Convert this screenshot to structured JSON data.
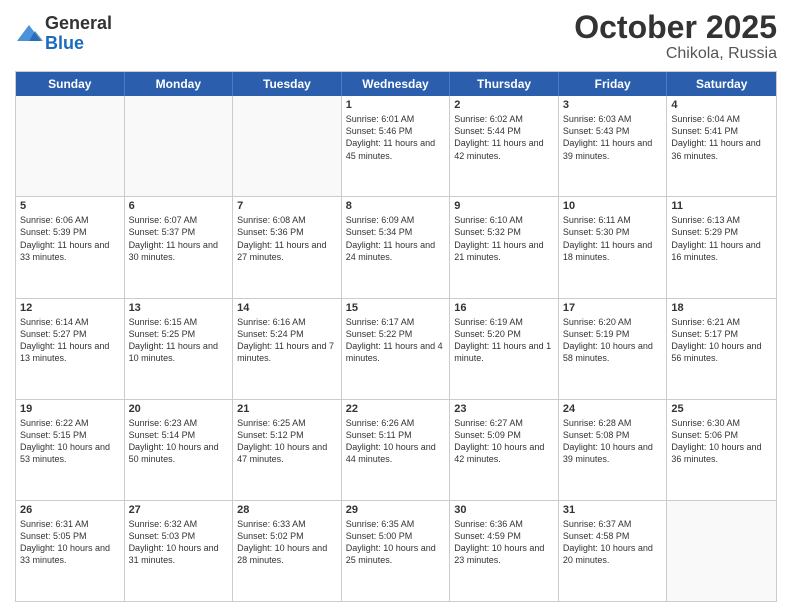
{
  "logo": {
    "general": "General",
    "blue": "Blue"
  },
  "header": {
    "month": "October 2025",
    "location": "Chikola, Russia"
  },
  "days": [
    "Sunday",
    "Monday",
    "Tuesday",
    "Wednesday",
    "Thursday",
    "Friday",
    "Saturday"
  ],
  "rows": [
    [
      {
        "day": "",
        "text": ""
      },
      {
        "day": "",
        "text": ""
      },
      {
        "day": "",
        "text": ""
      },
      {
        "day": "1",
        "text": "Sunrise: 6:01 AM\nSunset: 5:46 PM\nDaylight: 11 hours and 45 minutes."
      },
      {
        "day": "2",
        "text": "Sunrise: 6:02 AM\nSunset: 5:44 PM\nDaylight: 11 hours and 42 minutes."
      },
      {
        "day": "3",
        "text": "Sunrise: 6:03 AM\nSunset: 5:43 PM\nDaylight: 11 hours and 39 minutes."
      },
      {
        "day": "4",
        "text": "Sunrise: 6:04 AM\nSunset: 5:41 PM\nDaylight: 11 hours and 36 minutes."
      }
    ],
    [
      {
        "day": "5",
        "text": "Sunrise: 6:06 AM\nSunset: 5:39 PM\nDaylight: 11 hours and 33 minutes."
      },
      {
        "day": "6",
        "text": "Sunrise: 6:07 AM\nSunset: 5:37 PM\nDaylight: 11 hours and 30 minutes."
      },
      {
        "day": "7",
        "text": "Sunrise: 6:08 AM\nSunset: 5:36 PM\nDaylight: 11 hours and 27 minutes."
      },
      {
        "day": "8",
        "text": "Sunrise: 6:09 AM\nSunset: 5:34 PM\nDaylight: 11 hours and 24 minutes."
      },
      {
        "day": "9",
        "text": "Sunrise: 6:10 AM\nSunset: 5:32 PM\nDaylight: 11 hours and 21 minutes."
      },
      {
        "day": "10",
        "text": "Sunrise: 6:11 AM\nSunset: 5:30 PM\nDaylight: 11 hours and 18 minutes."
      },
      {
        "day": "11",
        "text": "Sunrise: 6:13 AM\nSunset: 5:29 PM\nDaylight: 11 hours and 16 minutes."
      }
    ],
    [
      {
        "day": "12",
        "text": "Sunrise: 6:14 AM\nSunset: 5:27 PM\nDaylight: 11 hours and 13 minutes."
      },
      {
        "day": "13",
        "text": "Sunrise: 6:15 AM\nSunset: 5:25 PM\nDaylight: 11 hours and 10 minutes."
      },
      {
        "day": "14",
        "text": "Sunrise: 6:16 AM\nSunset: 5:24 PM\nDaylight: 11 hours and 7 minutes."
      },
      {
        "day": "15",
        "text": "Sunrise: 6:17 AM\nSunset: 5:22 PM\nDaylight: 11 hours and 4 minutes."
      },
      {
        "day": "16",
        "text": "Sunrise: 6:19 AM\nSunset: 5:20 PM\nDaylight: 11 hours and 1 minute."
      },
      {
        "day": "17",
        "text": "Sunrise: 6:20 AM\nSunset: 5:19 PM\nDaylight: 10 hours and 58 minutes."
      },
      {
        "day": "18",
        "text": "Sunrise: 6:21 AM\nSunset: 5:17 PM\nDaylight: 10 hours and 56 minutes."
      }
    ],
    [
      {
        "day": "19",
        "text": "Sunrise: 6:22 AM\nSunset: 5:15 PM\nDaylight: 10 hours and 53 minutes."
      },
      {
        "day": "20",
        "text": "Sunrise: 6:23 AM\nSunset: 5:14 PM\nDaylight: 10 hours and 50 minutes."
      },
      {
        "day": "21",
        "text": "Sunrise: 6:25 AM\nSunset: 5:12 PM\nDaylight: 10 hours and 47 minutes."
      },
      {
        "day": "22",
        "text": "Sunrise: 6:26 AM\nSunset: 5:11 PM\nDaylight: 10 hours and 44 minutes."
      },
      {
        "day": "23",
        "text": "Sunrise: 6:27 AM\nSunset: 5:09 PM\nDaylight: 10 hours and 42 minutes."
      },
      {
        "day": "24",
        "text": "Sunrise: 6:28 AM\nSunset: 5:08 PM\nDaylight: 10 hours and 39 minutes."
      },
      {
        "day": "25",
        "text": "Sunrise: 6:30 AM\nSunset: 5:06 PM\nDaylight: 10 hours and 36 minutes."
      }
    ],
    [
      {
        "day": "26",
        "text": "Sunrise: 6:31 AM\nSunset: 5:05 PM\nDaylight: 10 hours and 33 minutes."
      },
      {
        "day": "27",
        "text": "Sunrise: 6:32 AM\nSunset: 5:03 PM\nDaylight: 10 hours and 31 minutes."
      },
      {
        "day": "28",
        "text": "Sunrise: 6:33 AM\nSunset: 5:02 PM\nDaylight: 10 hours and 28 minutes."
      },
      {
        "day": "29",
        "text": "Sunrise: 6:35 AM\nSunset: 5:00 PM\nDaylight: 10 hours and 25 minutes."
      },
      {
        "day": "30",
        "text": "Sunrise: 6:36 AM\nSunset: 4:59 PM\nDaylight: 10 hours and 23 minutes."
      },
      {
        "day": "31",
        "text": "Sunrise: 6:37 AM\nSunset: 4:58 PM\nDaylight: 10 hours and 20 minutes."
      },
      {
        "day": "",
        "text": ""
      }
    ]
  ]
}
